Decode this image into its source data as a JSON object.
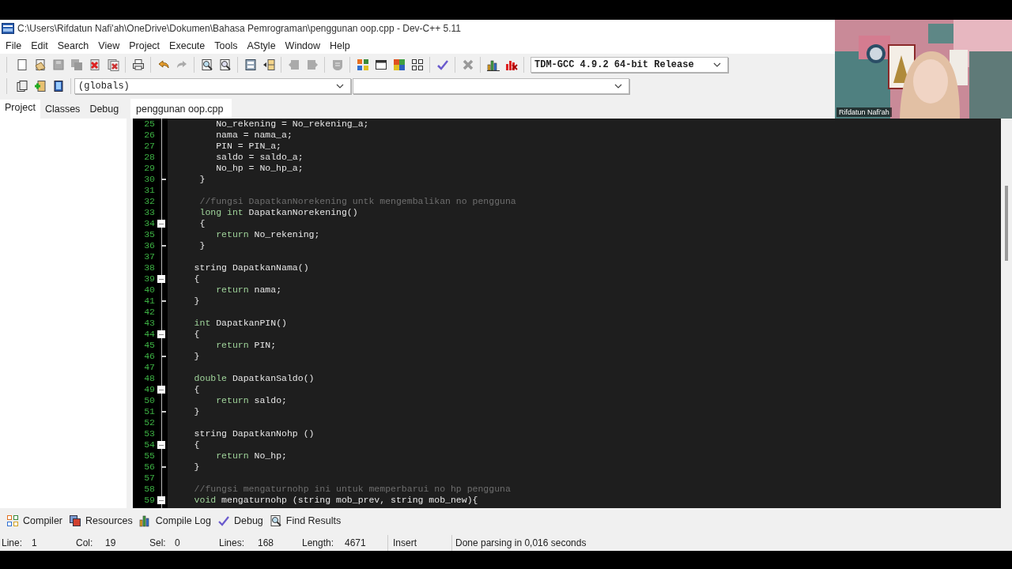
{
  "window": {
    "title": "C:\\Users\\Rifdatun Nafi'ah\\OneDrive\\Dokumen\\Bahasa Pemrograman\\penggunan oop.cpp - Dev-C++ 5.11"
  },
  "menu": [
    "File",
    "Edit",
    "Search",
    "View",
    "Project",
    "Execute",
    "Tools",
    "AStyle",
    "Window",
    "Help"
  ],
  "compiler_select": {
    "value": "TDM-GCC 4.9.2 64-bit Release"
  },
  "scope_select": {
    "value": "(globals)"
  },
  "sidebar_tabs": [
    {
      "label": "Project",
      "selected": true
    },
    {
      "label": "Classes",
      "selected": false
    },
    {
      "label": "Debug",
      "selected": false
    }
  ],
  "editor_tabs": [
    {
      "label": "penggunan oop.cpp",
      "selected": true
    }
  ],
  "code_lines": [
    {
      "n": "25",
      "fold_start": false,
      "fold_end": false,
      "tokens": [
        {
          "kind": "plain",
          "text": "        No_rekening = No_rekening_a;"
        }
      ]
    },
    {
      "n": "26",
      "fold_start": false,
      "fold_end": false,
      "tokens": [
        {
          "kind": "plain",
          "text": "        nama = nama_a;"
        }
      ]
    },
    {
      "n": "27",
      "fold_start": false,
      "fold_end": false,
      "tokens": [
        {
          "kind": "plain",
          "text": "        PIN = PIN_a;"
        }
      ]
    },
    {
      "n": "28",
      "fold_start": false,
      "fold_end": false,
      "tokens": [
        {
          "kind": "plain",
          "text": "        saldo = saldo_a;"
        }
      ]
    },
    {
      "n": "29",
      "fold_start": false,
      "fold_end": false,
      "tokens": [
        {
          "kind": "plain",
          "text": "        No_hp = No_hp_a;"
        }
      ]
    },
    {
      "n": "30",
      "fold_start": false,
      "fold_end": true,
      "tokens": [
        {
          "kind": "plain",
          "text": "     }"
        }
      ]
    },
    {
      "n": "31",
      "fold_start": false,
      "fold_end": false
    },
    {
      "n": "32",
      "fold_start": false,
      "fold_end": false,
      "tokens": [
        {
          "kind": "comment",
          "text": "     //fungsi DapatkanNorekening untk mengembalikan no pengguna"
        }
      ]
    },
    {
      "n": "33",
      "fold_start": false,
      "fold_end": false,
      "tokens": [
        {
          "kind": "keyword",
          "text": "     long int"
        },
        {
          "kind": "plain",
          "text": " DapatkanNorekening()"
        }
      ]
    },
    {
      "n": "34",
      "fold_start": true,
      "fold_end": false,
      "tokens": [
        {
          "kind": "plain",
          "text": "     {"
        }
      ]
    },
    {
      "n": "35",
      "fold_start": false,
      "fold_end": false,
      "tokens": [
        {
          "kind": "keyword",
          "text": "        return"
        },
        {
          "kind": "plain",
          "text": " No_rekening;"
        }
      ]
    },
    {
      "n": "36",
      "fold_start": false,
      "fold_end": true,
      "tokens": [
        {
          "kind": "plain",
          "text": "     }"
        }
      ]
    },
    {
      "n": "37",
      "fold_start": false,
      "fold_end": false
    },
    {
      "n": "38",
      "fold_start": false,
      "fold_end": false,
      "tokens": [
        {
          "kind": "plain",
          "text": "    string DapatkanNama()"
        }
      ]
    },
    {
      "n": "39",
      "fold_start": true,
      "fold_end": false,
      "tokens": [
        {
          "kind": "plain",
          "text": "    {"
        }
      ]
    },
    {
      "n": "40",
      "fold_start": false,
      "fold_end": false,
      "tokens": [
        {
          "kind": "keyword",
          "text": "        return"
        },
        {
          "kind": "plain",
          "text": " nama;"
        }
      ]
    },
    {
      "n": "41",
      "fold_start": false,
      "fold_end": true,
      "tokens": [
        {
          "kind": "plain",
          "text": "    }"
        }
      ]
    },
    {
      "n": "42",
      "fold_start": false,
      "fold_end": false
    },
    {
      "n": "43",
      "fold_start": false,
      "fold_end": false,
      "tokens": [
        {
          "kind": "keyword",
          "text": "    int"
        },
        {
          "kind": "plain",
          "text": " DapatkanPIN()"
        }
      ]
    },
    {
      "n": "44",
      "fold_start": true,
      "fold_end": false,
      "tokens": [
        {
          "kind": "plain",
          "text": "    {"
        }
      ]
    },
    {
      "n": "45",
      "fold_start": false,
      "fold_end": false,
      "tokens": [
        {
          "kind": "keyword",
          "text": "        return"
        },
        {
          "kind": "plain",
          "text": " PIN;"
        }
      ]
    },
    {
      "n": "46",
      "fold_start": false,
      "fold_end": true,
      "tokens": [
        {
          "kind": "plain",
          "text": "    }"
        }
      ]
    },
    {
      "n": "47",
      "fold_start": false,
      "fold_end": false
    },
    {
      "n": "48",
      "fold_start": false,
      "fold_end": false,
      "tokens": [
        {
          "kind": "keyword",
          "text": "    double"
        },
        {
          "kind": "plain",
          "text": " DapatkanSaldo()"
        }
      ]
    },
    {
      "n": "49",
      "fold_start": true,
      "fold_end": false,
      "tokens": [
        {
          "kind": "plain",
          "text": "    {"
        }
      ]
    },
    {
      "n": "50",
      "fold_start": false,
      "fold_end": false,
      "tokens": [
        {
          "kind": "keyword",
          "text": "        return"
        },
        {
          "kind": "plain",
          "text": " saldo;"
        }
      ]
    },
    {
      "n": "51",
      "fold_start": false,
      "fold_end": true,
      "tokens": [
        {
          "kind": "plain",
          "text": "    }"
        }
      ]
    },
    {
      "n": "52",
      "fold_start": false,
      "fold_end": false
    },
    {
      "n": "53",
      "fold_start": false,
      "fold_end": false,
      "tokens": [
        {
          "kind": "plain",
          "text": "    string DapatkanNohp ()"
        }
      ]
    },
    {
      "n": "54",
      "fold_start": true,
      "fold_end": false,
      "tokens": [
        {
          "kind": "plain",
          "text": "    {"
        }
      ]
    },
    {
      "n": "55",
      "fold_start": false,
      "fold_end": false,
      "tokens": [
        {
          "kind": "keyword",
          "text": "        return"
        },
        {
          "kind": "plain",
          "text": " No_hp;"
        }
      ]
    },
    {
      "n": "56",
      "fold_start": false,
      "fold_end": true,
      "tokens": [
        {
          "kind": "plain",
          "text": "    }"
        }
      ]
    },
    {
      "n": "57",
      "fold_start": false,
      "fold_end": false
    },
    {
      "n": "58",
      "fold_start": false,
      "fold_end": false,
      "tokens": [
        {
          "kind": "comment",
          "text": "    //fungsi mengaturnohp ini untuk memperbarui no hp pengguna"
        }
      ]
    },
    {
      "n": "59",
      "fold_start": true,
      "fold_end": false,
      "tokens": [
        {
          "kind": "keyword",
          "text": "    void"
        },
        {
          "kind": "plain",
          "text": " mengaturnohp (string mob_prev, string mob_new){"
        }
      ]
    }
  ],
  "bottom_tabs": [
    {
      "kind": "compiler",
      "label": "Compiler"
    },
    {
      "kind": "resources",
      "label": "Resources"
    },
    {
      "kind": "log",
      "label": "Compile Log"
    },
    {
      "kind": "debug",
      "label": "Debug"
    },
    {
      "kind": "find",
      "label": "Find Results"
    }
  ],
  "status_bar": {
    "fields": [
      {
        "label": "Line:",
        "value": "1"
      },
      {
        "label": "Col:",
        "value": "19"
      },
      {
        "label": "Sel:",
        "value": "0"
      },
      {
        "label": "Lines:",
        "value": "168"
      },
      {
        "label": "Length:",
        "value": "4671"
      }
    ],
    "mode": "Insert",
    "message": "Done parsing in 0,016 seconds"
  },
  "webcam": {
    "kind": "picture",
    "name": "Rifdatun Nafi'ah"
  }
}
